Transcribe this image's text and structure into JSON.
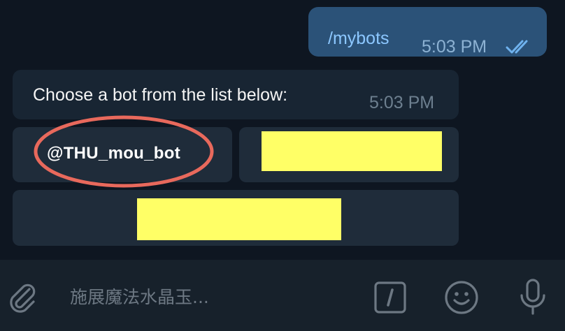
{
  "messages": {
    "outgoing": {
      "text": "/mybots",
      "time": "5:03 PM",
      "status_icon": "double-check-icon"
    },
    "incoming": {
      "text": "Choose a bot from the list below:",
      "time": "5:03 PM"
    }
  },
  "keyboard": {
    "buttons": [
      {
        "label": "@THU_mou_bot",
        "highlighted": true,
        "highlight_color": "#e8695c"
      },
      {
        "label": "",
        "redacted": true,
        "redaction_color": "#ffff66"
      },
      {
        "label": "",
        "redacted": true,
        "redaction_color": "#ffff66"
      }
    ]
  },
  "composer": {
    "placeholder": "施展魔法水晶玉...",
    "icons": [
      "paperclip-icon",
      "command-icon",
      "emoji-icon",
      "microphone-icon"
    ]
  },
  "colors": {
    "background": "#0e1621",
    "outgoing_bubble": "#2b5278",
    "incoming_bubble": "#182533",
    "keyboard_button": "#1f2c3a",
    "composer_bg": "#17212b",
    "accent_link": "#8cc7ff"
  }
}
